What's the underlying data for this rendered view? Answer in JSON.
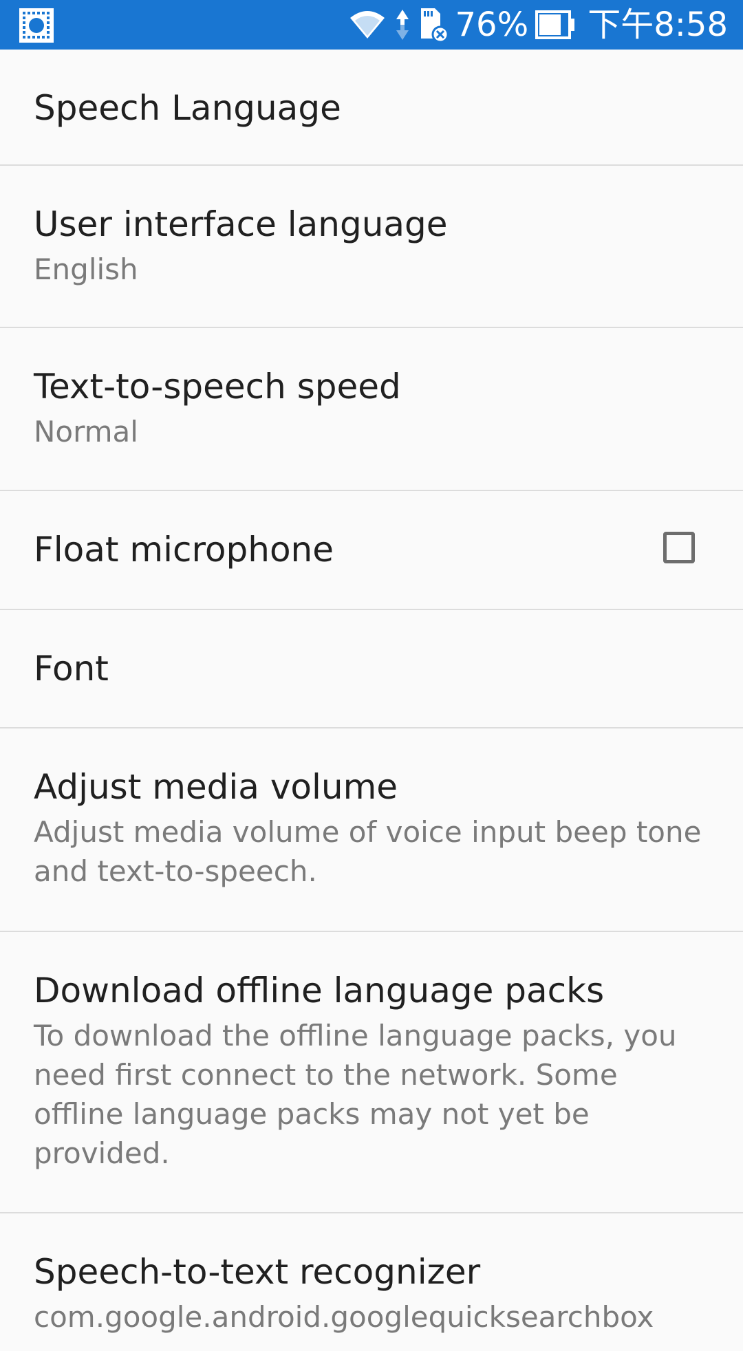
{
  "status_bar": {
    "battery_percent": "76%",
    "clock": "下午8:58",
    "icons": [
      "app-notification-icon",
      "wifi-icon",
      "data-arrows-icon",
      "sd-card-icon",
      "battery-icon"
    ]
  },
  "settings": {
    "items": [
      {
        "title": "Speech Language"
      },
      {
        "title": "User interface language",
        "summary": "English"
      },
      {
        "title": "Text-to-speech speed",
        "summary": "Normal"
      },
      {
        "title": "Float microphone",
        "checked": false
      },
      {
        "title": "Font"
      },
      {
        "title": "Adjust media volume",
        "summary": "Adjust media volume of voice input beep tone and text-to-speech."
      },
      {
        "title": "Download offline language packs",
        "summary": "To download the offline language packs, you need first connect to the network. Some offline language packs may not yet be provided."
      },
      {
        "title": "Speech-to-text recognizer",
        "summary": "com.google.android.googlequicksearchbox"
      }
    ]
  },
  "colors": {
    "status_bar": "#1976d2",
    "background": "#fafafa",
    "divider": "#dcdcdc",
    "title_text": "#202020",
    "summary_text": "#7a7a7a"
  }
}
